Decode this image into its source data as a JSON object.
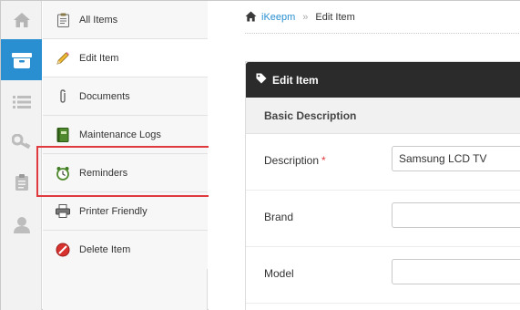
{
  "rail": {
    "items": [
      {
        "icon": "home-icon"
      },
      {
        "icon": "archive-box-icon",
        "active": true
      },
      {
        "icon": "list-icon"
      },
      {
        "icon": "key-icon"
      },
      {
        "icon": "clipboard-icon"
      },
      {
        "icon": "user-icon"
      }
    ],
    "accent": "#2a8fd0"
  },
  "submenu": {
    "items": [
      {
        "label": "All Items",
        "icon": "clipboard-icon"
      },
      {
        "label": "Edit Item",
        "icon": "pencil-icon",
        "active": true
      },
      {
        "label": "Documents",
        "icon": "paperclip-icon"
      },
      {
        "label": "Maintenance Logs",
        "icon": "logbook-icon"
      },
      {
        "label": "Reminders",
        "icon": "alarm-clock-icon",
        "highlighted": true
      },
      {
        "label": "Printer Friendly",
        "icon": "printer-icon"
      },
      {
        "label": "Delete Item",
        "icon": "delete-icon"
      }
    ],
    "highlight_color": "#e0393e"
  },
  "breadcrumb": {
    "home": "iKeepm",
    "separator": "»",
    "current": "Edit Item"
  },
  "panel": {
    "title": "Edit Item",
    "section": "Basic Description",
    "fields": [
      {
        "label": "Description",
        "required": "*",
        "value": "Samsung LCD TV"
      },
      {
        "label": "Brand",
        "required": "",
        "value": ""
      },
      {
        "label": "Model",
        "required": "",
        "value": ""
      }
    ]
  }
}
